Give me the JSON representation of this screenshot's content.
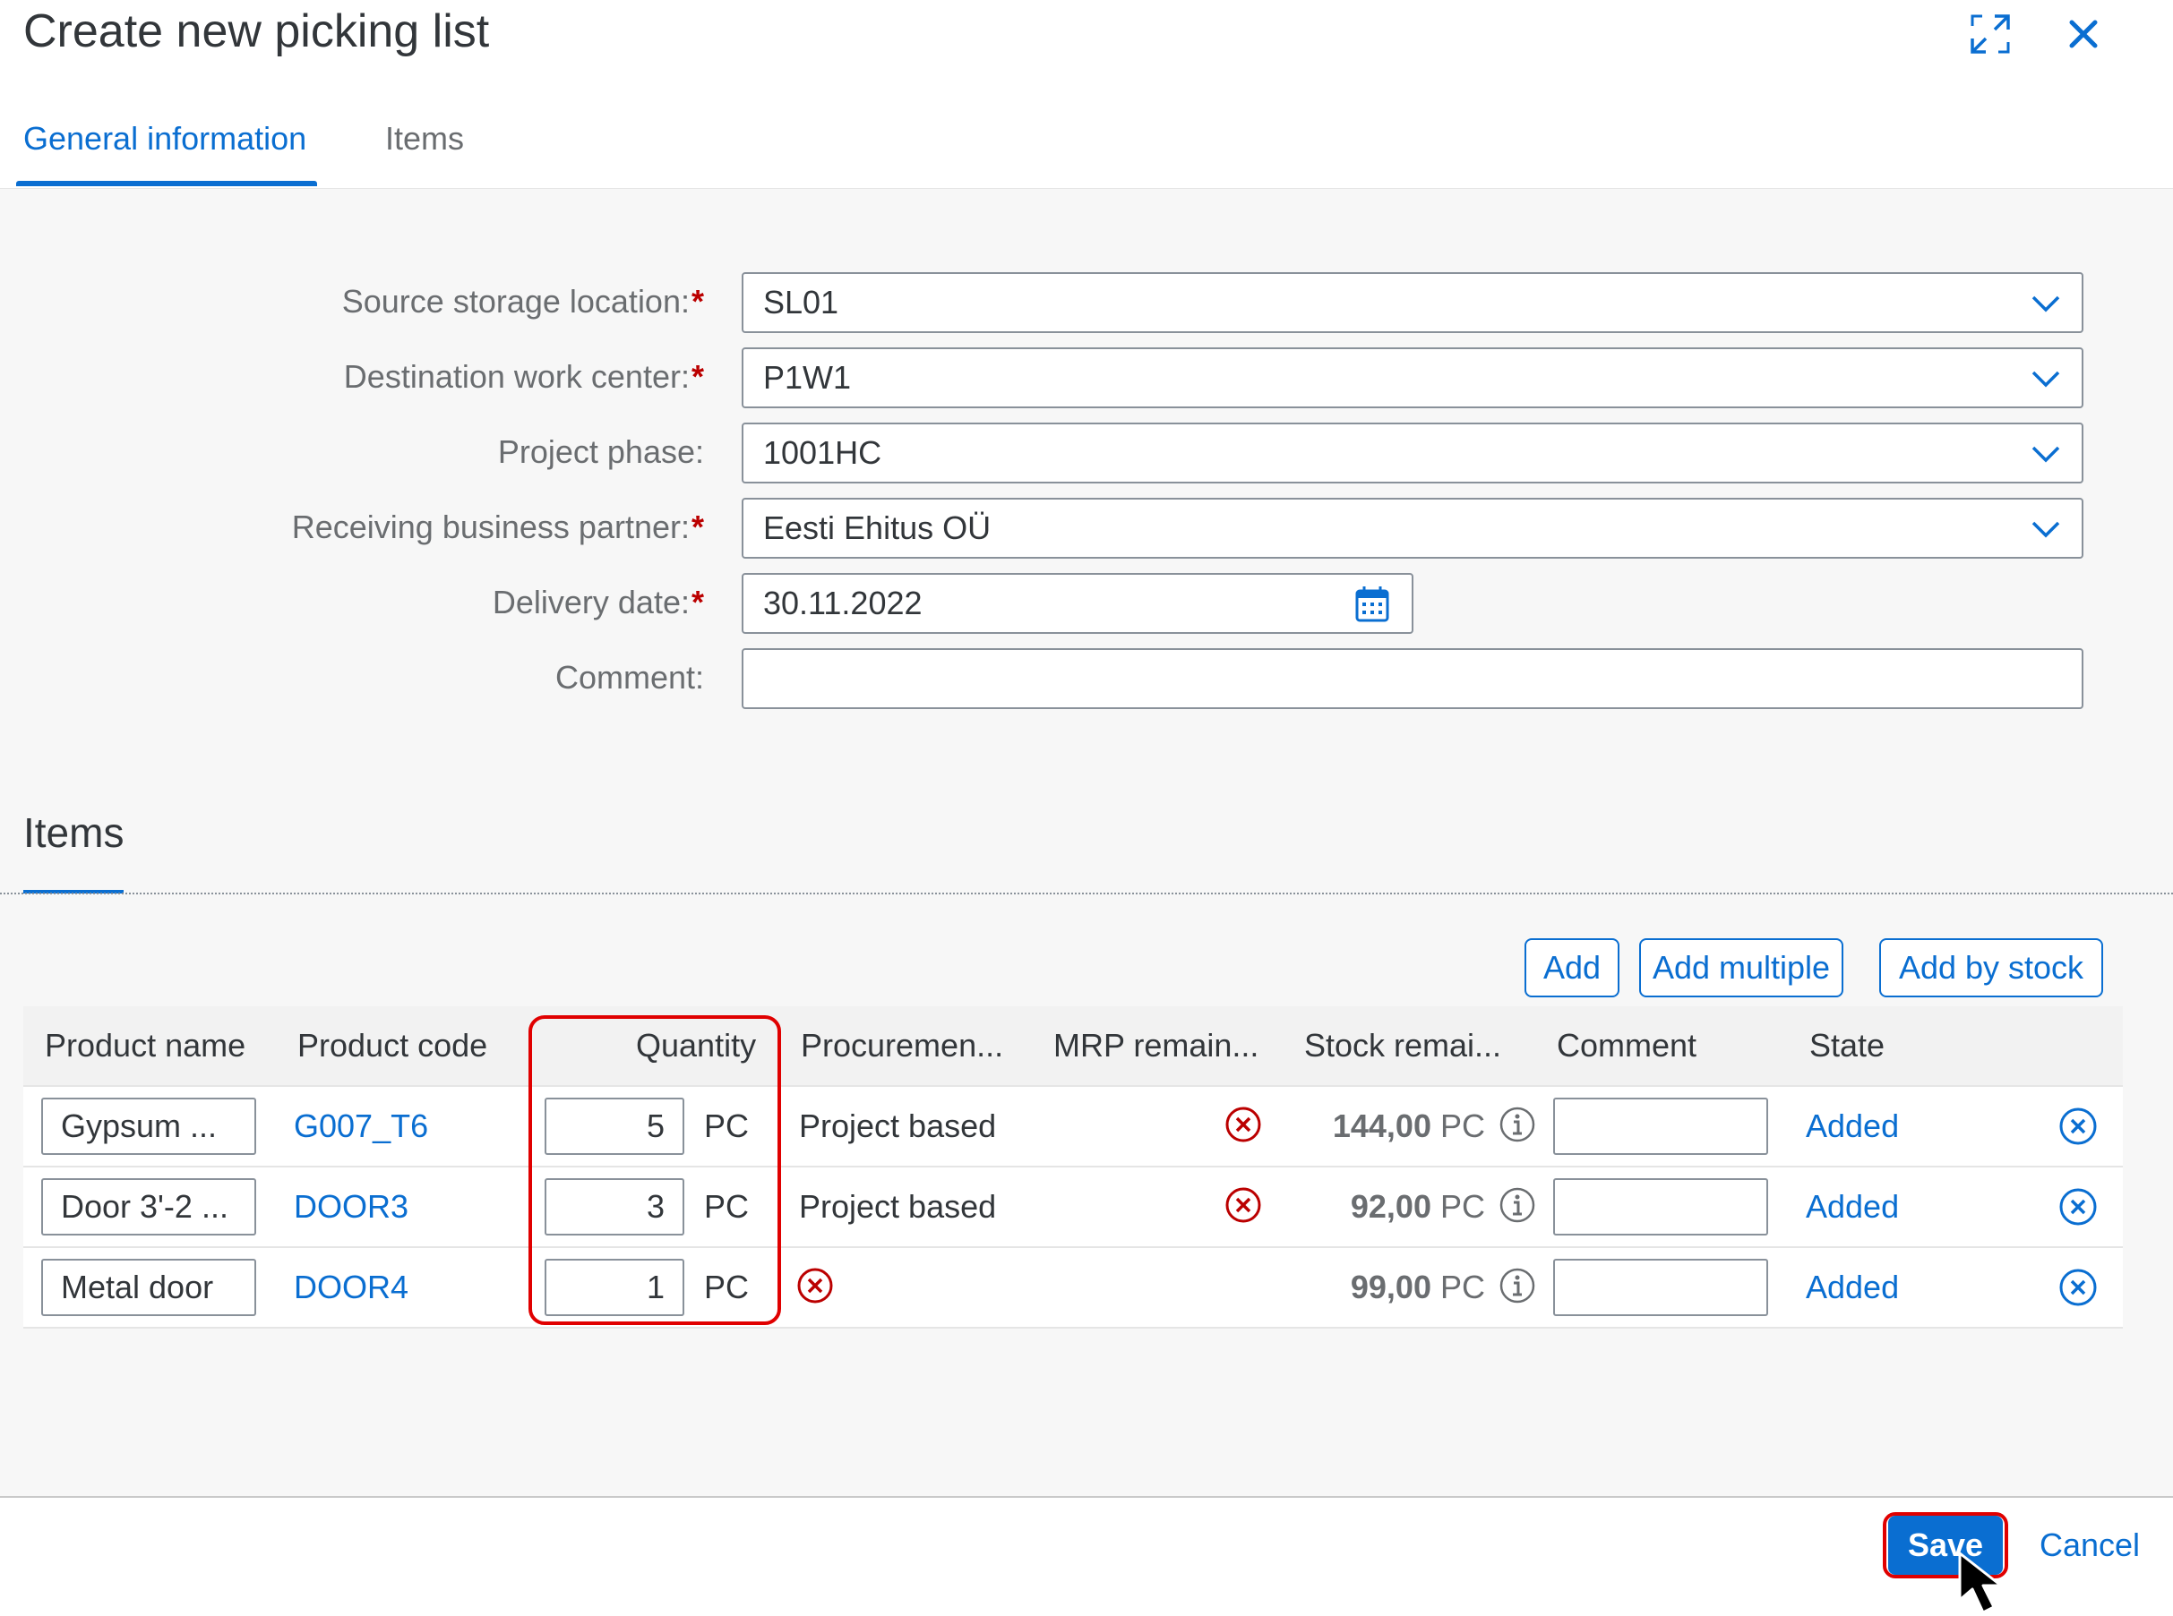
{
  "dialog": {
    "title": "Create new picking list",
    "expand_icon": "expand-icon",
    "close_icon": "close-icon"
  },
  "tabs": [
    {
      "label": "General information",
      "active": true
    },
    {
      "label": "Items",
      "active": false
    }
  ],
  "form": {
    "required_marker": "*",
    "fields": [
      {
        "label": "Source storage location:",
        "required": true,
        "value": "SL01",
        "type": "dropdown"
      },
      {
        "label": "Destination work center:",
        "required": true,
        "value": "P1W1",
        "type": "dropdown"
      },
      {
        "label": "Project phase:",
        "required": false,
        "value": "1001HC",
        "type": "dropdown"
      },
      {
        "label": "Receiving business partner:",
        "required": true,
        "value": "Eesti Ehitus OÜ",
        "type": "dropdown"
      },
      {
        "label": "Delivery date:",
        "required": true,
        "value": "30.11.2022",
        "type": "date"
      },
      {
        "label": "Comment:",
        "required": false,
        "value": "",
        "type": "text"
      }
    ]
  },
  "items_section": {
    "title": "Items",
    "toolbar": {
      "add": "Add",
      "add_multiple": "Add multiple",
      "add_by_stock": "Add by stock"
    },
    "columns": [
      "Product name",
      "Product code",
      "Quantity",
      "Procuremen...",
      "MRP remain...",
      "Stock remai...",
      "Comment",
      "State"
    ],
    "rows": [
      {
        "product_name": "Gypsum ...",
        "product_code": "G007_T6",
        "quantity": "5",
        "unit": "PC",
        "procurement": "Project based",
        "mrp_error": true,
        "stock_value": "144,00",
        "stock_unit": "PC",
        "comment": "",
        "state": "Added"
      },
      {
        "product_name": "Door 3'-2 ...",
        "product_code": "DOOR3",
        "quantity": "3",
        "unit": "PC",
        "procurement": "Project based",
        "mrp_error": true,
        "stock_value": "92,00",
        "stock_unit": "PC",
        "comment": "",
        "state": "Added"
      },
      {
        "product_name": "Metal door",
        "product_code": "DOOR4",
        "quantity": "1",
        "unit": "PC",
        "procurement": "",
        "procurement_error": true,
        "mrp_error": false,
        "stock_value": "99,00",
        "stock_unit": "PC",
        "comment": "",
        "state": "Added"
      }
    ]
  },
  "footer": {
    "save": "Save",
    "cancel": "Cancel"
  },
  "colors": {
    "accent": "#0a6ed1",
    "error": "#bb0000",
    "highlight": "#e00000"
  }
}
